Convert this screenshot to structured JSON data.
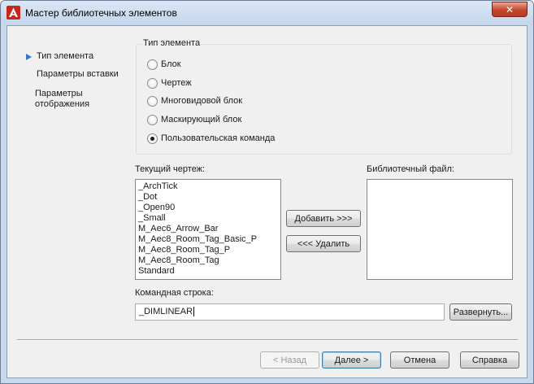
{
  "window": {
    "title": "Мастер библиотечных элементов",
    "close_glyph": "✕"
  },
  "nav": {
    "items": [
      "Тип элемента",
      "Параметры вставки",
      "Параметры",
      "отображения"
    ]
  },
  "element_type": {
    "group_title": "Тип элемента",
    "options": [
      "Блок",
      "Чертеж",
      "Многовидовой блок",
      "Маскирующий блок",
      "Пользовательская команда"
    ],
    "selected_index": 4
  },
  "current_drawing": {
    "label": "Текущий чертеж:",
    "items": [
      "_ArchTick",
      "_Dot",
      "_Open90",
      "_Small",
      "M_Aec6_Arrow_Bar",
      "M_Aec8_Room_Tag_Basic_P",
      "M_Aec8_Room_Tag_P",
      "M_Aec8_Room_Tag",
      "Standard"
    ]
  },
  "library_file": {
    "label": "Библиотечный файл:",
    "items": []
  },
  "transfer": {
    "add_label": "Добавить >>>",
    "remove_label": "<<< Удалить"
  },
  "command_line": {
    "label": "Командная строка:",
    "value": "_DIMLINEAR",
    "expand_label": "Развернуть..."
  },
  "footer": {
    "back_label": "< Назад",
    "next_label": "Далее >",
    "cancel_label": "Отмена",
    "help_label": "Справка"
  },
  "colors": {
    "accent_arrow": "#3a73c2",
    "close_button": "#c6462c",
    "frame": "#c9d9ec"
  }
}
